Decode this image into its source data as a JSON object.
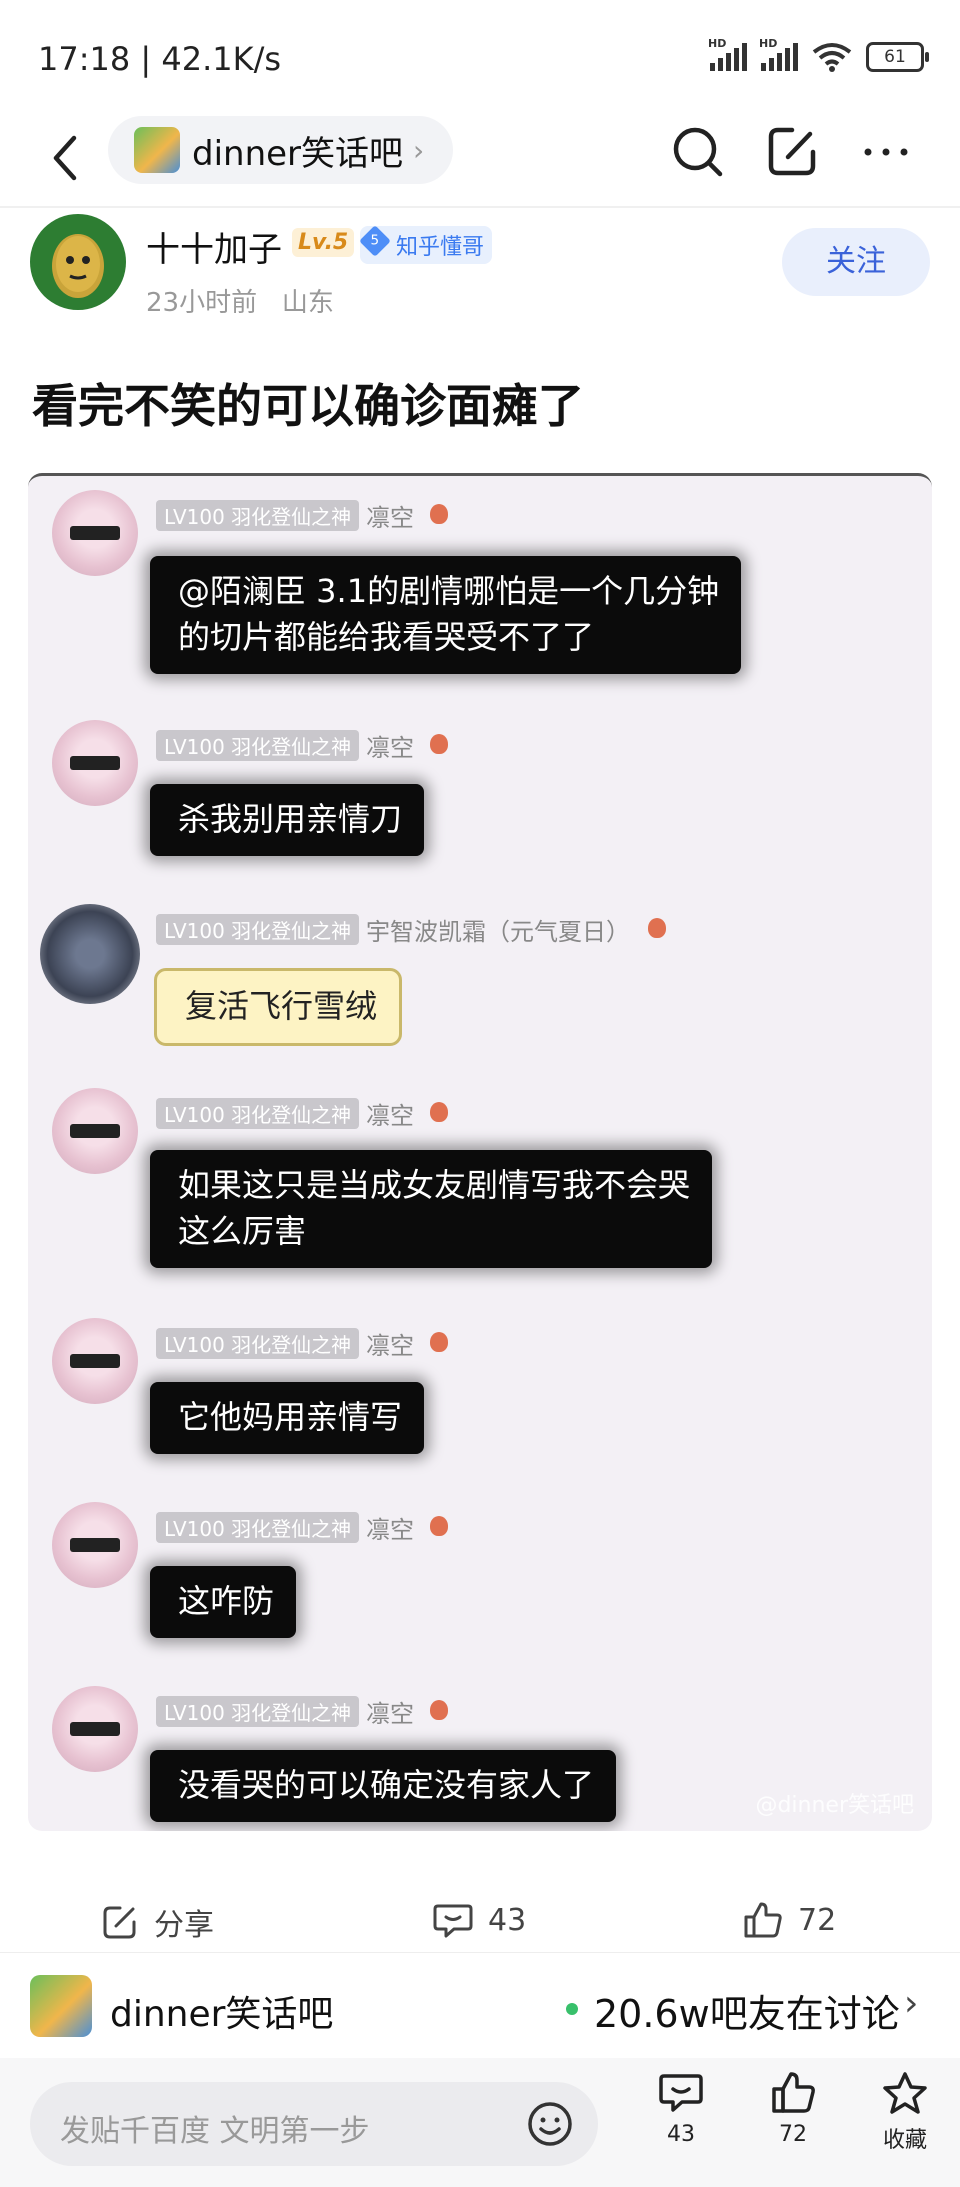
{
  "status_bar": {
    "time": "17:18 | 42.1K/s",
    "battery": "61"
  },
  "nav": {
    "forum_name": "dinner笑话吧",
    "icons": [
      "back-icon",
      "search-icon",
      "edit-icon",
      "more-icon"
    ]
  },
  "author": {
    "name": "十十加子",
    "level": "Lv.5",
    "badge_number": "5",
    "badge": "知乎懂哥",
    "time": "23小时前",
    "location": "山东",
    "follow_label": "关注"
  },
  "post": {
    "title": "看完不笑的可以确诊面瘫了"
  },
  "chat": {
    "watermark": "@dinner笑话吧",
    "messages": [
      {
        "level": "LV100 羽化登仙之神",
        "name": "凛空",
        "text": "@陌澜臣 3.1的剧情哪怕是一个几分钟\n的切片都能给我看哭受不了了"
      },
      {
        "level": "LV100 羽化登仙之神",
        "name": "凛空",
        "text": "杀我别用亲情刀"
      },
      {
        "level": "LV100 羽化登仙之神",
        "name": "宇智波凯霜（元气夏日）",
        "text": "复活飞行雪绒"
      },
      {
        "level": "LV100 羽化登仙之神",
        "name": "凛空",
        "text": "如果这只是当成女友剧情写我不会哭\n这么厉害"
      },
      {
        "level": "LV100 羽化登仙之神",
        "name": "凛空",
        "text": "它他妈用亲情写"
      },
      {
        "level": "LV100 羽化登仙之神",
        "name": "凛空",
        "text": "这咋防"
      },
      {
        "level": "LV100 羽化登仙之神",
        "name": "凛空",
        "text": "没看哭的可以确定没有家人了"
      }
    ]
  },
  "stats": {
    "share": "分享",
    "comments": "43",
    "likes": "72"
  },
  "forum_bar": {
    "name": "dinner笑话吧",
    "online": "20.6w吧友在讨论"
  },
  "bottom_bar": {
    "placeholder": "发贴千百度 文明第一步",
    "comments": "43",
    "likes": "72",
    "favorite": "收藏"
  }
}
